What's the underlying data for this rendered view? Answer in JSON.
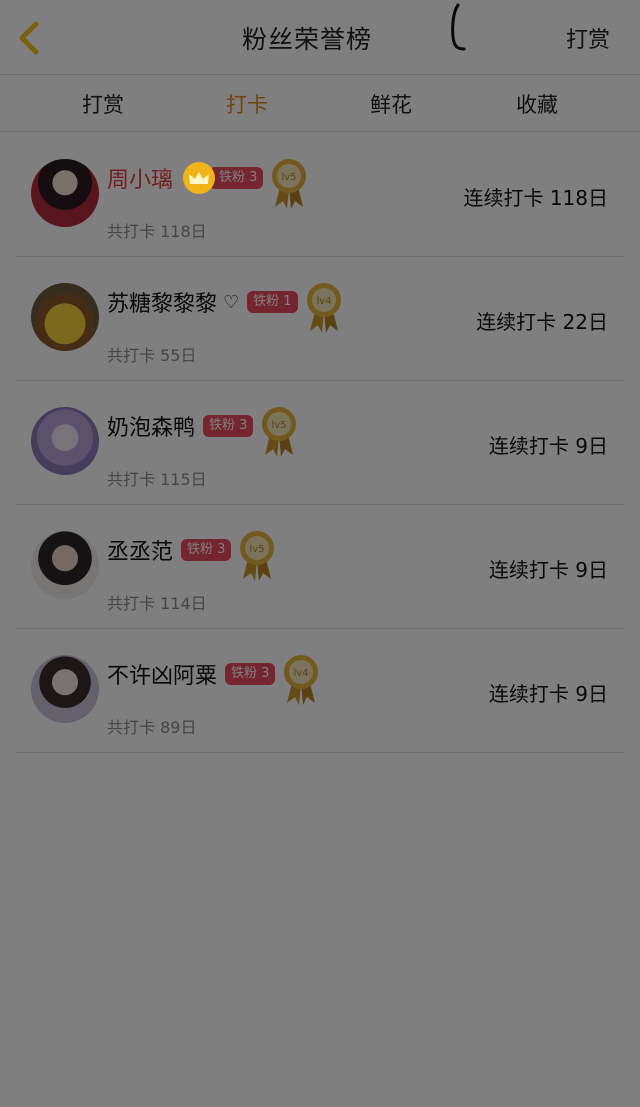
{
  "header": {
    "title": "粉丝荣誉榜",
    "action": "打赏"
  },
  "tabs": [
    {
      "label": "打赏",
      "active": false
    },
    {
      "label": "打卡",
      "active": true
    },
    {
      "label": "鲜花",
      "active": false
    },
    {
      "label": "收藏",
      "active": false
    }
  ],
  "rows": [
    {
      "name": "周小璃",
      "highlight": true,
      "crown": true,
      "badge": "铁粉 3",
      "medal": "lv5",
      "total": "共打卡 118日",
      "streak": "连续打卡 118日"
    },
    {
      "name": "苏糖黎黎黎",
      "heart": "♡",
      "badge": "铁粉 1",
      "medal": "lv4",
      "total": "共打卡 55日",
      "streak": "连续打卡 22日"
    },
    {
      "name": "奶泡森鸭",
      "badge": "铁粉 3",
      "medal": "lv5",
      "total": "共打卡 115日",
      "streak": "连续打卡 9日"
    },
    {
      "name": "丞丞范",
      "badge": "铁粉 3",
      "medal": "lv5",
      "total": "共打卡 114日",
      "streak": "连续打卡 9日"
    },
    {
      "name": "不许凶阿粟",
      "badge": "铁粉 3",
      "medal": "lv4",
      "total": "共打卡 89日",
      "streak": "连续打卡 9日"
    }
  ],
  "colors": {
    "accent": "#e08a1e",
    "badge": "#e84a5f",
    "highlight_name": "#e23c3c",
    "overlay": "#000000"
  },
  "overlay_opacity": 0.5
}
